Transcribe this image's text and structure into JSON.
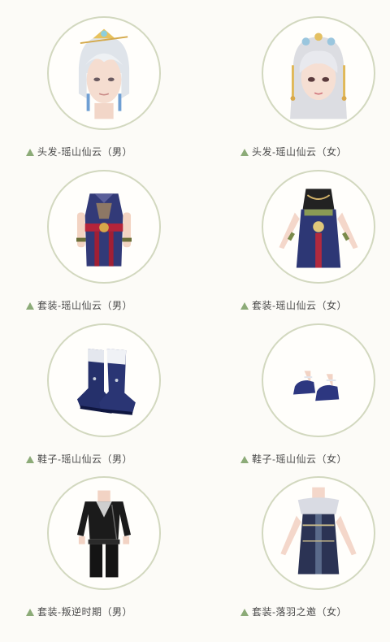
{
  "colors": {
    "accent_triangle": "#8cab78",
    "circle_border": "#d2d8bf",
    "background": "#fcfbf7",
    "caption_text": "#4a4a4a"
  },
  "items": [
    {
      "label": "头发-瑶山仙云（男）",
      "icon": "hair-male-icon"
    },
    {
      "label": "头发-瑶山仙云（女）",
      "icon": "hair-female-icon"
    },
    {
      "label": "套装-瑶山仙云（男）",
      "icon": "outfit-male-icon"
    },
    {
      "label": "套装-瑶山仙云（女）",
      "icon": "outfit-female-icon"
    },
    {
      "label": "鞋子-瑶山仙云（男）",
      "icon": "boots-male-icon"
    },
    {
      "label": "鞋子-瑶山仙云（女）",
      "icon": "shoes-female-icon"
    },
    {
      "label": "套装-叛逆时期（男）",
      "icon": "outfit-rebel-male-icon"
    },
    {
      "label": "套装-落羽之邀（女）",
      "icon": "outfit-feather-female-icon"
    }
  ]
}
